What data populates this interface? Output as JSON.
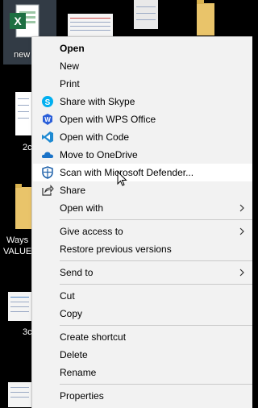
{
  "desktop": {
    "file_label": "new",
    "label_2c": "2c",
    "label_ways": "Ways",
    "label_value": "VALUE",
    "label_3c": "3c"
  },
  "menu": {
    "items": [
      {
        "label": "Open",
        "bold": true
      },
      {
        "label": "New"
      },
      {
        "label": "Print"
      },
      {
        "label": "Share with Skype",
        "icon": "skype-icon"
      },
      {
        "label": "Open with WPS Office",
        "icon": "wps-office-icon"
      },
      {
        "label": "Open with Code",
        "icon": "vscode-icon"
      },
      {
        "label": "Move to OneDrive",
        "icon": "onedrive-icon"
      },
      {
        "label": "Scan with Microsoft Defender...",
        "icon": "defender-shield-icon",
        "hovered": true
      },
      {
        "label": "Share",
        "icon": "share-icon"
      },
      {
        "label": "Open with",
        "submenu": true
      },
      {
        "label": "Give access to",
        "submenu": true
      },
      {
        "label": "Restore previous versions"
      },
      {
        "label": "Send to",
        "submenu": true
      },
      {
        "label": "Cut"
      },
      {
        "label": "Copy"
      },
      {
        "label": "Create shortcut"
      },
      {
        "label": "Delete"
      },
      {
        "label": "Rename"
      },
      {
        "label": "Properties"
      }
    ]
  },
  "colors": {
    "menu_bg": "#f2f2f2",
    "hover_bg": "#ffffff",
    "skype": "#00aff0",
    "wps": "#2b5fd9",
    "vscode": "#1f8ad2",
    "onedrive": "#1a73c8",
    "excel": "#1d6f42"
  }
}
